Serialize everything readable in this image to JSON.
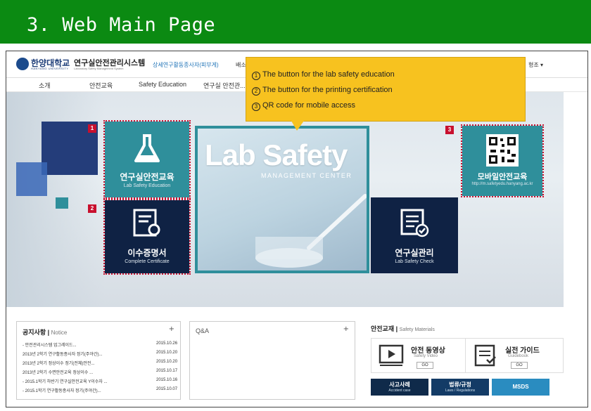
{
  "slide": {
    "title": "3. Web Main Page"
  },
  "site": {
    "univ_name": "한양대학교",
    "univ_sub": "HANYANG UNIVERSITY",
    "system_name": "연구실안전관리시스템",
    "system_sub": "Laboratory Safety Management System",
    "top_link_1": "상세연구활동종사자(피부게)",
    "top_link_2": "배소",
    "lang": "형조 ▾"
  },
  "nav": [
    "소개",
    "안전교육",
    "Safety Education",
    "연구실 안전관..."
  ],
  "callout": {
    "lines": [
      {
        "num": "1",
        "text": "The button for the lab safety education"
      },
      {
        "num": "2",
        "text": "The button for the printing certification"
      },
      {
        "num": "3",
        "text": "QR code for mobile access"
      }
    ]
  },
  "tiles": {
    "education": {
      "title": "연구실안전교육",
      "sub": "Lab Safety Education",
      "tag": "1"
    },
    "certificate": {
      "title": "이수증명서",
      "sub": "Complete Certificate",
      "tag": "2"
    },
    "mobile": {
      "title": "모바일안전교육",
      "sub": "http://m.safetyedu.hanyang.ac.kr",
      "tag": "3"
    },
    "lab_check": {
      "title": "연구실관리",
      "sub": "Lab Safety Check"
    },
    "hero": {
      "main": "Lab Safety",
      "sub": "Management Center"
    }
  },
  "notice": {
    "title": "공지사항",
    "title_en": "Notice",
    "plus": "+",
    "rows": [
      {
        "text": "- 안전관리시스템 업그레이드...",
        "date": "2015.10.26"
      },
      {
        "text": "2013년 2학기 연구활동종사자 정기(주야간)...",
        "date": "2015.10.20"
      },
      {
        "text": "2013년 2학기 정상이수 정기(전체)안전...",
        "date": "2015.10.20"
      },
      {
        "text": "2013년 2학기 수면안전교육 정상이수 ...",
        "date": "2015.10.17"
      },
      {
        "text": "- 2015.1학기 하반기 연구실안전교육 Y이수자 ...",
        "date": "2015.10.16"
      },
      {
        "text": "- 2015.1학기 연구활동종사자 정기(주야간)...",
        "date": "2015.10.07"
      }
    ]
  },
  "qa": {
    "title": "Q&A",
    "plus": "+"
  },
  "materials": {
    "title": "안전교재",
    "title_en": "Safety Materials",
    "video": {
      "name": "안전 동영상",
      "en": "Safety Video",
      "go": "GO"
    },
    "guide": {
      "name": "실전 가이드",
      "en": "Guidebook",
      "go": "GO"
    },
    "buttons": [
      {
        "k": "사고사례",
        "e": "Accident case",
        "color": "#0f2a4a"
      },
      {
        "k": "법류/규정",
        "e": "Laws / Regulations",
        "color": "#133b66"
      },
      {
        "k": "MSDS",
        "e": "",
        "color": "#2a8cc0"
      }
    ]
  },
  "colors": {
    "header_green": "#0b8a12",
    "tile_teal": "#2f8f9b",
    "tile_navy": "#0f2244",
    "callout_yellow": "#f7c21f",
    "marker_red": "#c8102e"
  }
}
